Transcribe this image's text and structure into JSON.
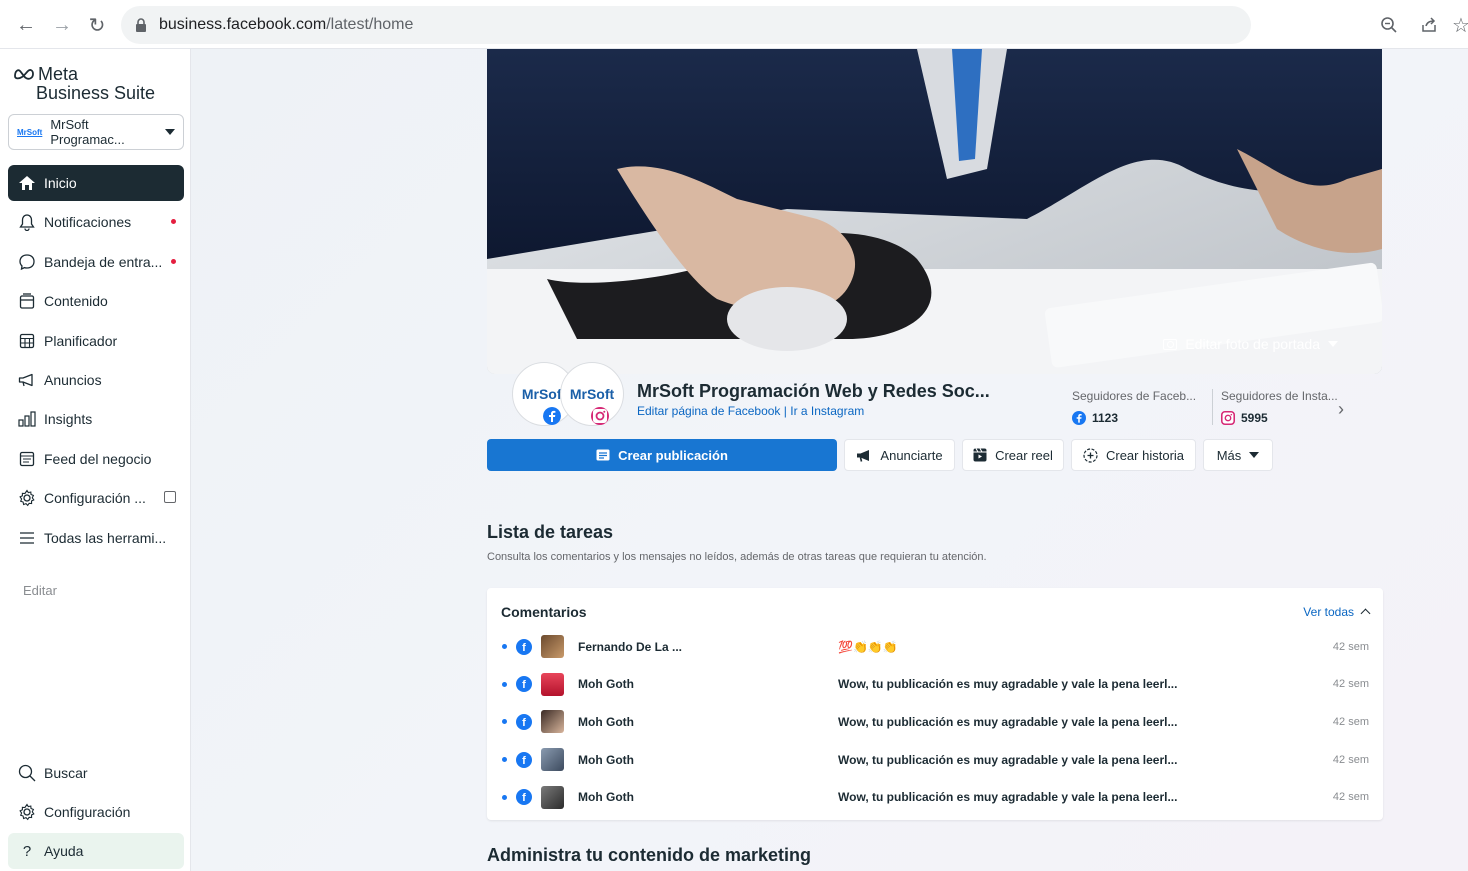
{
  "browser": {
    "url_host": "business.facebook.com",
    "url_path": "/latest/home"
  },
  "sidebar": {
    "logo_meta": "Meta",
    "logo_suite": "Business Suite",
    "account": {
      "logo_text": "MrSoft",
      "name": "MrSoft Programac..."
    },
    "items": [
      {
        "label": "Inicio",
        "icon": "home-icon",
        "active": true
      },
      {
        "label": "Notificaciones",
        "icon": "bell-icon",
        "dot": true
      },
      {
        "label": "Bandeja de entra...",
        "icon": "chat-bubble-icon",
        "dot": true
      },
      {
        "label": "Contenido",
        "icon": "content-icon"
      },
      {
        "label": "Planificador",
        "icon": "calendar-icon"
      },
      {
        "label": "Anuncios",
        "icon": "megaphone-icon"
      },
      {
        "label": "Insights",
        "icon": "bar-chart-icon"
      },
      {
        "label": "Feed del negocio",
        "icon": "feed-icon"
      },
      {
        "label": "Configuración ...",
        "icon": "gear-icon",
        "external": true
      },
      {
        "label": "Todas las herrami...",
        "icon": "menu-icon"
      }
    ],
    "edit_label": "Editar",
    "bottom": [
      {
        "label": "Buscar",
        "icon": "search-icon"
      },
      {
        "label": "Configuración",
        "icon": "gear-icon"
      },
      {
        "label": "Ayuda",
        "icon": "help-icon"
      }
    ]
  },
  "page": {
    "edit_cover": "Editar foto de portada",
    "avatar_text": "MrSoft",
    "name": "MrSoft Programación Web y Redes Soc...",
    "link_fb": "Editar página de Facebook",
    "link_sep": " | ",
    "link_ig": "Ir a Instagram",
    "fb_followers_label": "Seguidores de Faceb...",
    "fb_followers": "1123",
    "ig_followers_label": "Seguidores de Insta...",
    "ig_followers": "5995"
  },
  "actions": {
    "create_post": "Crear publicación",
    "advertise": "Anunciarte",
    "create_reel": "Crear reel",
    "create_story": "Crear historia",
    "more": "Más"
  },
  "tasks": {
    "title": "Lista de tareas",
    "subtitle": "Consulta los comentarios y los mensajes no leídos, además de otras tareas que requieran tu atención."
  },
  "comments": {
    "title": "Comentarios",
    "see_all": "Ver todas",
    "rows": [
      {
        "author": "Fernando De La ...",
        "text": "💯👏👏👏",
        "time": "42 sem"
      },
      {
        "author": "Moh Goth",
        "text": "Wow, tu publicación es muy agradable y vale la pena leerl...",
        "time": "42 sem"
      },
      {
        "author": "Moh Goth",
        "text": "Wow, tu publicación es muy agradable y vale la pena leerl...",
        "time": "42 sem"
      },
      {
        "author": "Moh Goth",
        "text": "Wow, tu publicación es muy agradable y vale la pena leerl...",
        "time": "42 sem"
      },
      {
        "author": "Moh Goth",
        "text": "Wow, tu publicación es muy agradable y vale la pena leerl...",
        "time": "42 sem"
      }
    ]
  },
  "marketing_title": "Administra tu contenido de marketing"
}
